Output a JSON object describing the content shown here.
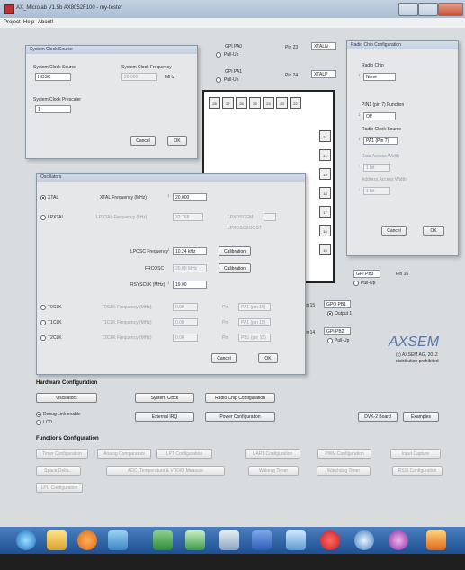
{
  "window": {
    "title": "AX_Microlab V1.5b  AX8052F100 - my-tester",
    "menu": [
      "Project",
      "Help",
      "About!"
    ]
  },
  "sysclock_dialog": {
    "title": "System Clock Source",
    "source_label": "System Clock Source",
    "freq_label": "System Clock Frequency",
    "source_value": "HOSC",
    "freq_value": "20.000",
    "freq_unit": "MHz",
    "prescaler_label": "System Clock Prescaler",
    "prescaler_value": "1",
    "cancel": "Cancel",
    "ok": "OK"
  },
  "pins": {
    "top": [
      {
        "name": "GPI PA0",
        "pull": "Pull-Up"
      },
      {
        "name": "GPI PA1",
        "pull": "Pull-Up"
      }
    ],
    "pin23": {
      "num": "Pin 23",
      "name": "XTALN"
    },
    "pin24": {
      "num": "Pin 24",
      "name": "XTALP"
    },
    "chip_numbers": [
      "28",
      "27",
      "26",
      "25",
      "24",
      "23",
      "22"
    ],
    "right_numbers": [
      "21",
      "20",
      "19",
      "18",
      "17",
      "16",
      "15"
    ],
    "bottom_num": "14",
    "pb3": {
      "name": "GPI PB3",
      "pin": "Pin 16",
      "pull": "Pull-Up"
    },
    "pb1": {
      "num": "Pin 15",
      "name": "GPO PB1",
      "option": "Output 1"
    },
    "pb2": {
      "num": "Pin 14",
      "name": "GPI PB2",
      "pull": "Pull-Up"
    }
  },
  "radio_chip": {
    "title": "Radio Chip Configuration",
    "chip_label": "Radio Chip",
    "chip_value": "None",
    "pin_label": "PIN1 (pin 7) Function",
    "pin_value": "Off",
    "clock_label": "Radio Clock Source",
    "clock_value": "PA1 (Pin 7)",
    "data_width_label": "Data Access Width",
    "data_width_value": "1 bit",
    "addr_width_label": "Address Access Width",
    "addr_width_value": "1 bit",
    "cancel": "Cancel",
    "ok": "OK"
  },
  "oscillators": {
    "title": "Oscillators",
    "xtal": {
      "label": "XTAL",
      "freq_label": "XTAL Frequency (MHz)",
      "value": "20.000"
    },
    "lpxtal": {
      "label": "LPXTAL",
      "freq_label": "LPXTAL Frequency (kHz)",
      "value": "32.768",
      "extra1": "LPXOSCGM",
      "extra2": "LPXOSCBOOST"
    },
    "lposc": {
      "label": "LPOSC Frequency",
      "value": "10.24 kHz",
      "btn": "Calibration"
    },
    "frcosc": {
      "label": "FRCOSC",
      "value": "20.00 MHz",
      "btn": "Calibration"
    },
    "rsysclk": {
      "label": "RSYSCLK (MHz)",
      "value": "19.00"
    },
    "tclks": [
      {
        "label": "T0CLK",
        "freq_label": "T0CLK Frequency (MHz)",
        "value": "0.00",
        "pin_label": "Pin",
        "pin_value": "PA1 (pin 15)"
      },
      {
        "label": "T1CLK",
        "freq_label": "T1CLK Frequency (MHz)",
        "value": "0.00",
        "pin_label": "Pin",
        "pin_value": "PA1 (pin 15)"
      },
      {
        "label": "T2CLK",
        "freq_label": "T2CLK Frequency (MHz)",
        "value": "0.00",
        "pin_label": "Pin",
        "pin_value": "PB1 (pin 15)"
      }
    ],
    "cancel": "Cancel",
    "ok": "OK"
  },
  "axsem": {
    "logo": "AXSEM",
    "copyright": "(c) AXSEM AG, 2012",
    "note": "distribution prohibited"
  },
  "hardware": {
    "title": "Hardware Configuration",
    "buttons": [
      "Oscillators",
      "System Clock",
      "Radio Chip Configuration",
      "External IRQ",
      "Power Configuration"
    ],
    "debug": "Debug Link enable",
    "lcd": "LCD",
    "dvk2": "DVK-2 Board",
    "examples": "Examples"
  },
  "functions": {
    "title": "Functions Configuration",
    "row1": [
      "Timer Configuration",
      "Analog Comparators",
      "LPT Configuration",
      "UART Configuration",
      "PWM Configuration",
      "Input Capture"
    ],
    "row2": [
      "Space Delta...",
      "ADC, Temperature & VDDIO Measure",
      "Wakeup Timer",
      "Watchdog Timer",
      "RSSI Configuration"
    ],
    "row3": [
      "LPU Configuration"
    ]
  },
  "colors": {
    "taskbar": "#2c5fa3",
    "axsem": "#5577aa"
  }
}
